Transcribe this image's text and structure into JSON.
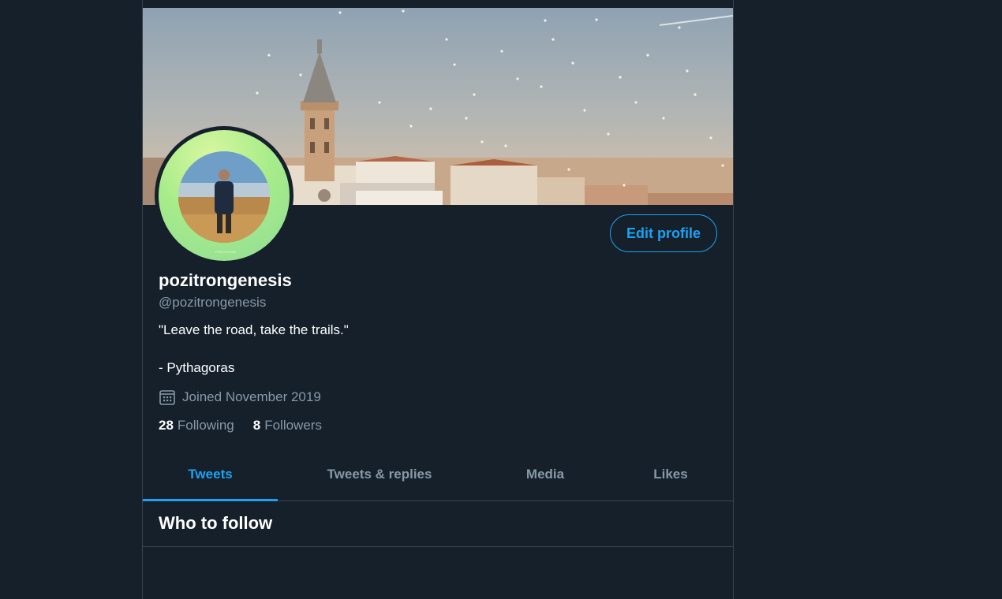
{
  "profile": {
    "display_name": "pozitrongenesis",
    "handle": "@pozitrongenesis",
    "bio_line_1": "\"Leave the road, take the trails.\"",
    "bio_line_2": "- Pythagoras",
    "joined": "Joined November 2019",
    "avatar_watermark": "PIXYLIS.COM"
  },
  "actions": {
    "edit_profile_label": "Edit profile"
  },
  "stats": {
    "following_count": "28",
    "following_label": "Following",
    "followers_count": "8",
    "followers_label": "Followers"
  },
  "tabs": [
    {
      "label": "Tweets",
      "active": true
    },
    {
      "label": "Tweets & replies",
      "active": false
    },
    {
      "label": "Media",
      "active": false
    },
    {
      "label": "Likes",
      "active": false
    }
  ],
  "who_to_follow": {
    "title": "Who to follow"
  },
  "colors": {
    "background": "#15202b",
    "accent": "#1da1f2",
    "muted_text": "#8899a6",
    "border": "#38444d"
  },
  "icons": {
    "joined": "calendar-icon"
  }
}
